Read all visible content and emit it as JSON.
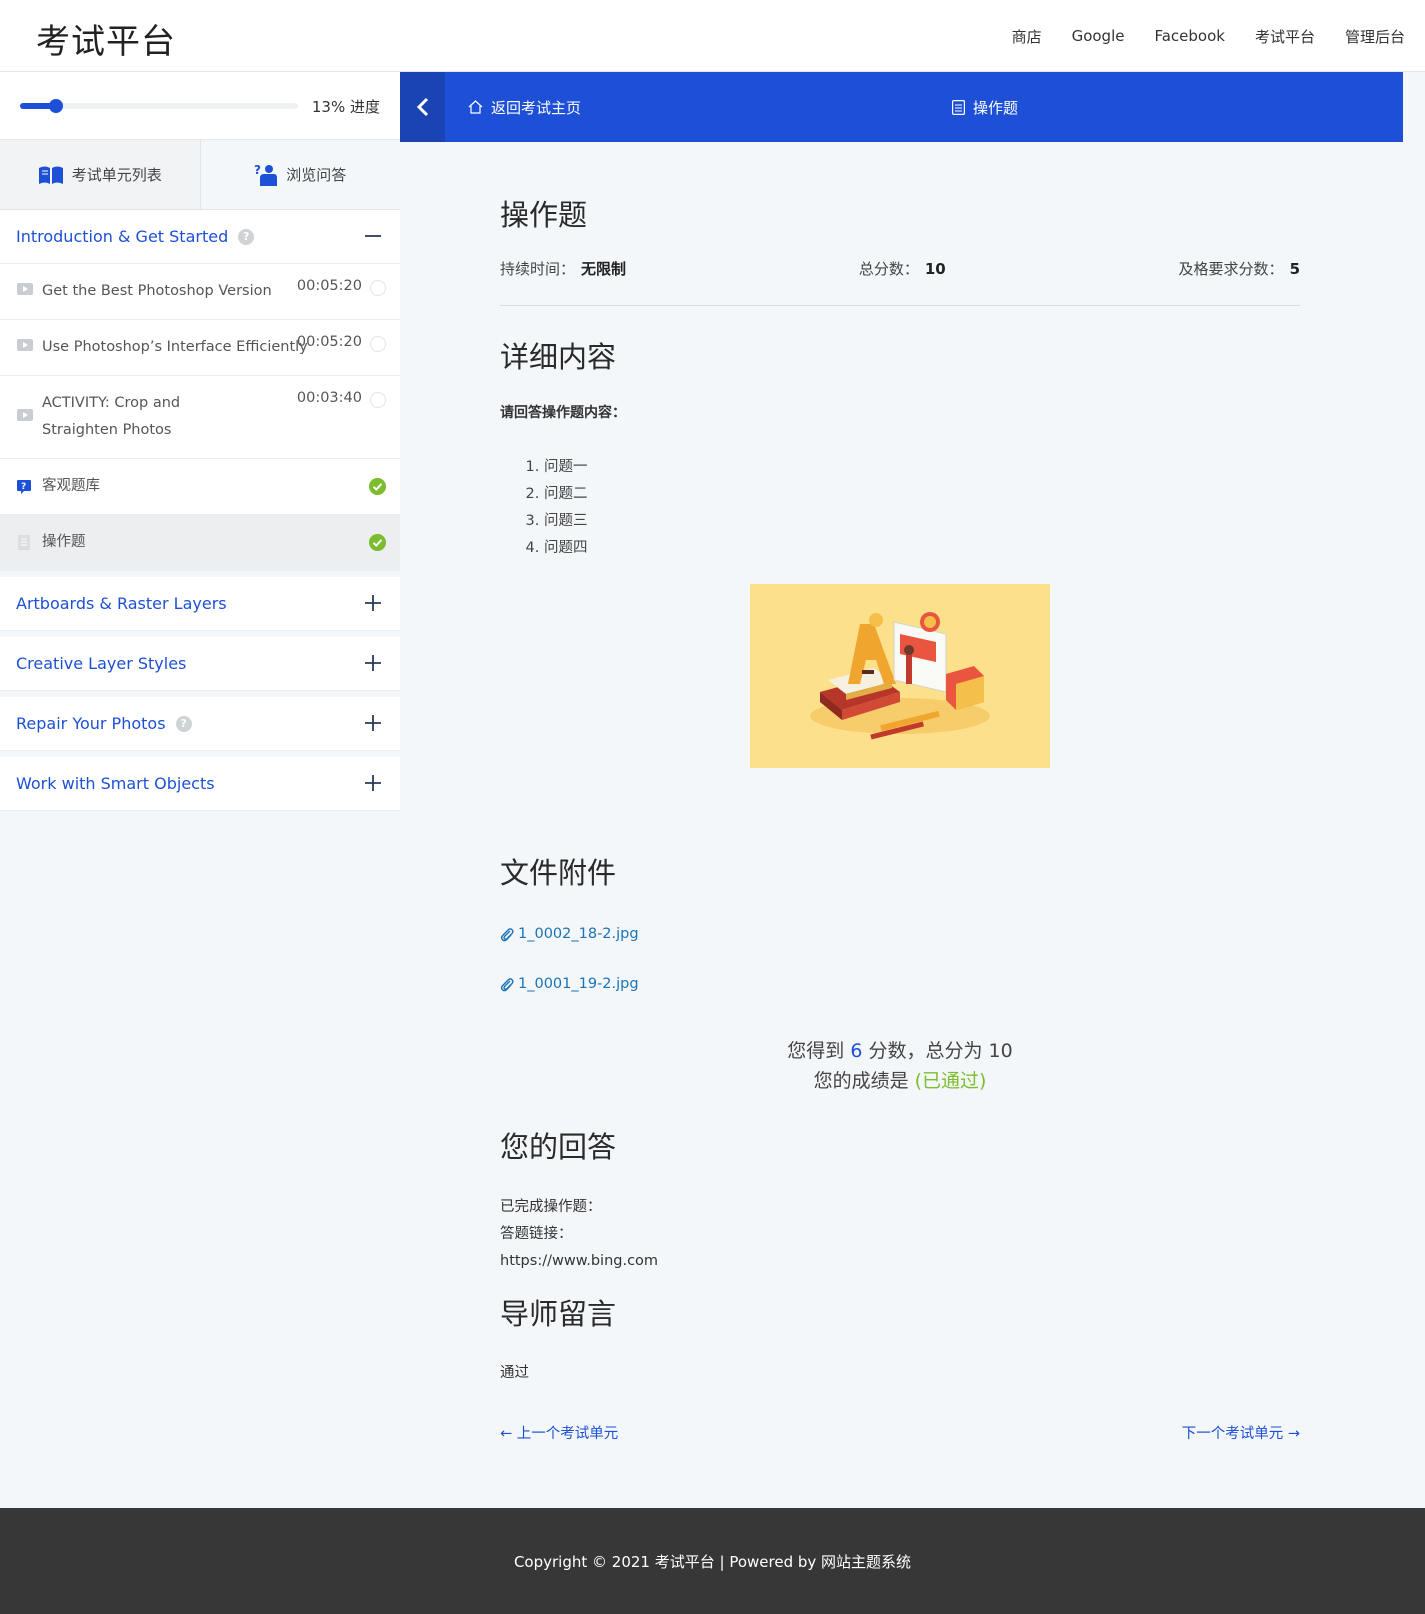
{
  "header": {
    "logo": "考试平台",
    "nav": [
      "商店",
      "Google",
      "Facebook",
      "考试平台",
      "管理后台"
    ]
  },
  "sidebar": {
    "progress_percent": 13,
    "progress_label": "13% 进度",
    "tabs": [
      "考试单元列表",
      "浏览问答"
    ],
    "sections": [
      {
        "title": "Introduction & Get Started",
        "has_help": true,
        "expanded": true,
        "items": [
          {
            "title": "Get the Best Photoshop Version",
            "time": "00:05:20",
            "type": "video",
            "done": false
          },
          {
            "title": "Use Photoshop’s Interface Efficiently",
            "time": "00:05:20",
            "type": "video",
            "done": false
          },
          {
            "title": "ACTIVITY: Crop and Straighten Photos",
            "time": "00:03:40",
            "type": "video",
            "done": false
          },
          {
            "title": "客观题库",
            "time": "",
            "type": "quiz",
            "done": true
          },
          {
            "title": "操作题",
            "time": "",
            "type": "assignment",
            "done": true,
            "current": true
          }
        ]
      },
      {
        "title": "Artboards & Raster Layers",
        "has_help": false,
        "expanded": false
      },
      {
        "title": "Creative Layer Styles",
        "has_help": false,
        "expanded": false
      },
      {
        "title": "Repair Your Photos",
        "has_help": true,
        "expanded": false
      },
      {
        "title": "Work with Smart Objects",
        "has_help": false,
        "expanded": false
      }
    ]
  },
  "content_bar": {
    "home_label": "返回考试主页",
    "current_label": "操作题"
  },
  "main": {
    "title": "操作题",
    "meta": {
      "duration_label": "持续时间：",
      "duration_value": "无限制",
      "total_label": "总分数：",
      "total_value": "10",
      "pass_label": "及格要求分数：",
      "pass_value": "5"
    },
    "detail_heading": "详细内容",
    "prompt": "请回答操作题内容：",
    "questions": [
      "问题一",
      "问题二",
      "问题三",
      "问题四"
    ],
    "files_heading": "文件附件",
    "files": [
      "1_0002_18-2.jpg",
      "1_0001_19-2.jpg"
    ],
    "score": {
      "line1_pre": "您得到 ",
      "score": "6",
      "line1_post": " 分数，总分为 10",
      "line2_pre": "您的成绩是 ",
      "status": "(已通过)"
    },
    "answer_heading": "您的回答",
    "answer_lines": [
      "已完成操作题：",
      "答题链接：",
      "https://www.bing.com"
    ],
    "mentor_heading": "导师留言",
    "mentor_text": "通过",
    "prev_label": "← 上一个考试单元",
    "next_label": "下一个考试单元 →"
  },
  "footer": {
    "text": "Copyright © 2021 考试平台 | Powered by 网站主题系统"
  },
  "colors": {
    "brand": "#1d50d6",
    "success": "#7cbd2e",
    "footer_bg": "#373737",
    "link": "#1a73b8"
  }
}
